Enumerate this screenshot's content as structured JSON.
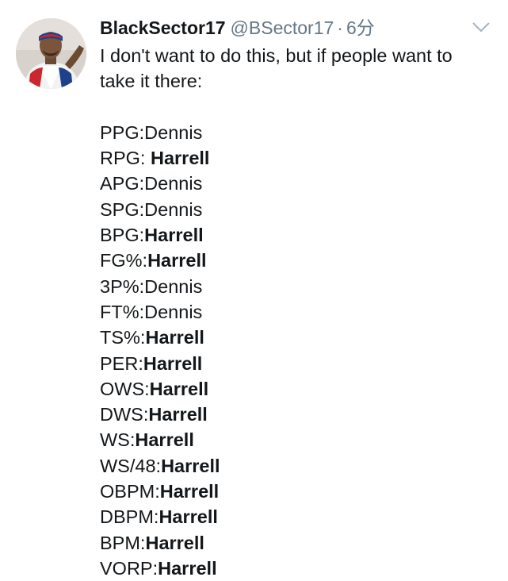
{
  "tweet": {
    "display_name": "BlackSector17",
    "handle": "@BSector17",
    "separator": "·",
    "time": "6分",
    "intro": "I don't want to do this, but if people want to take it there:",
    "stats": [
      {
        "label": "PPG:",
        "value": "Dennis",
        "bold": false
      },
      {
        "label": "RPG: ",
        "value": "Harrell",
        "bold": true
      },
      {
        "label": "APG:",
        "value": "Dennis",
        "bold": false
      },
      {
        "label": "SPG:",
        "value": "Dennis",
        "bold": false
      },
      {
        "label": "BPG:",
        "value": "Harrell",
        "bold": true
      },
      {
        "label": "FG%:",
        "value": "Harrell",
        "bold": true
      },
      {
        "label": "3P%:",
        "value": "Dennis",
        "bold": false
      },
      {
        "label": "FT%:",
        "value": "Dennis",
        "bold": false
      },
      {
        "label": "TS%:",
        "value": "Harrell",
        "bold": true
      },
      {
        "label": "PER:",
        "value": "Harrell",
        "bold": true
      },
      {
        "label": "OWS:",
        "value": "Harrell",
        "bold": true
      },
      {
        "label": "DWS:",
        "value": "Harrell",
        "bold": true
      },
      {
        "label": "WS:",
        "value": "Harrell",
        "bold": true
      },
      {
        "label": "WS/48:",
        "value": "Harrell",
        "bold": true
      },
      {
        "label": "OBPM:",
        "value": "Harrell",
        "bold": true
      },
      {
        "label": "DBPM:",
        "value": "Harrell",
        "bold": true
      },
      {
        "label": "BPM:",
        "value": "Harrell",
        "bold": true
      },
      {
        "label": "VORP:",
        "value": "Harrell",
        "bold": true
      }
    ]
  },
  "icons": {
    "avatar": "profile-photo",
    "caret": "chevron-down-icon"
  },
  "colors": {
    "text": "#14171a",
    "secondary": "#657786",
    "background": "#ffffff"
  }
}
